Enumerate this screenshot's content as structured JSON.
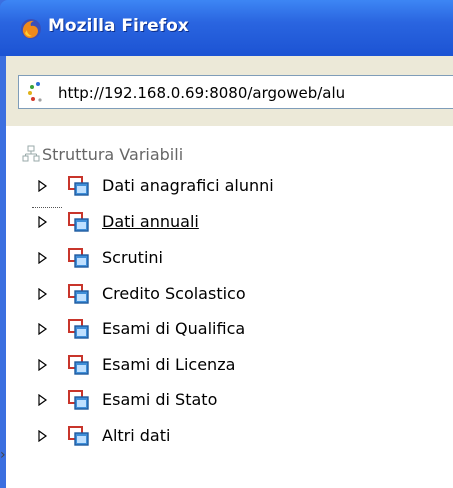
{
  "window": {
    "title": "Mozilla Firefox",
    "url": "http://192.168.0.69:8080/argoweb/alu"
  },
  "tree": {
    "root_label": "Struttura Variabili",
    "items": [
      {
        "label": "Dati anagrafici alunni",
        "underlined": false
      },
      {
        "label": "Dati annuali",
        "underlined": true
      },
      {
        "label": "Scrutini",
        "underlined": false
      },
      {
        "label": "Credito Scolastico",
        "underlined": false
      },
      {
        "label": "Esami di Qualifica",
        "underlined": false
      },
      {
        "label": "Esami di Licenza",
        "underlined": false
      },
      {
        "label": "Esami di Stato",
        "underlined": false
      },
      {
        "label": "Altri dati",
        "underlined": false
      }
    ]
  },
  "colors": {
    "titlebar": "#2a65e0",
    "folder_red": "#c8352b",
    "folder_blue": "#2f7fd0"
  },
  "icons": {
    "app": "firefox-icon",
    "page": "page-loading-icon",
    "root": "tree-root-icon",
    "node": "folder-window-icon",
    "expander": "triangle-right-icon"
  }
}
